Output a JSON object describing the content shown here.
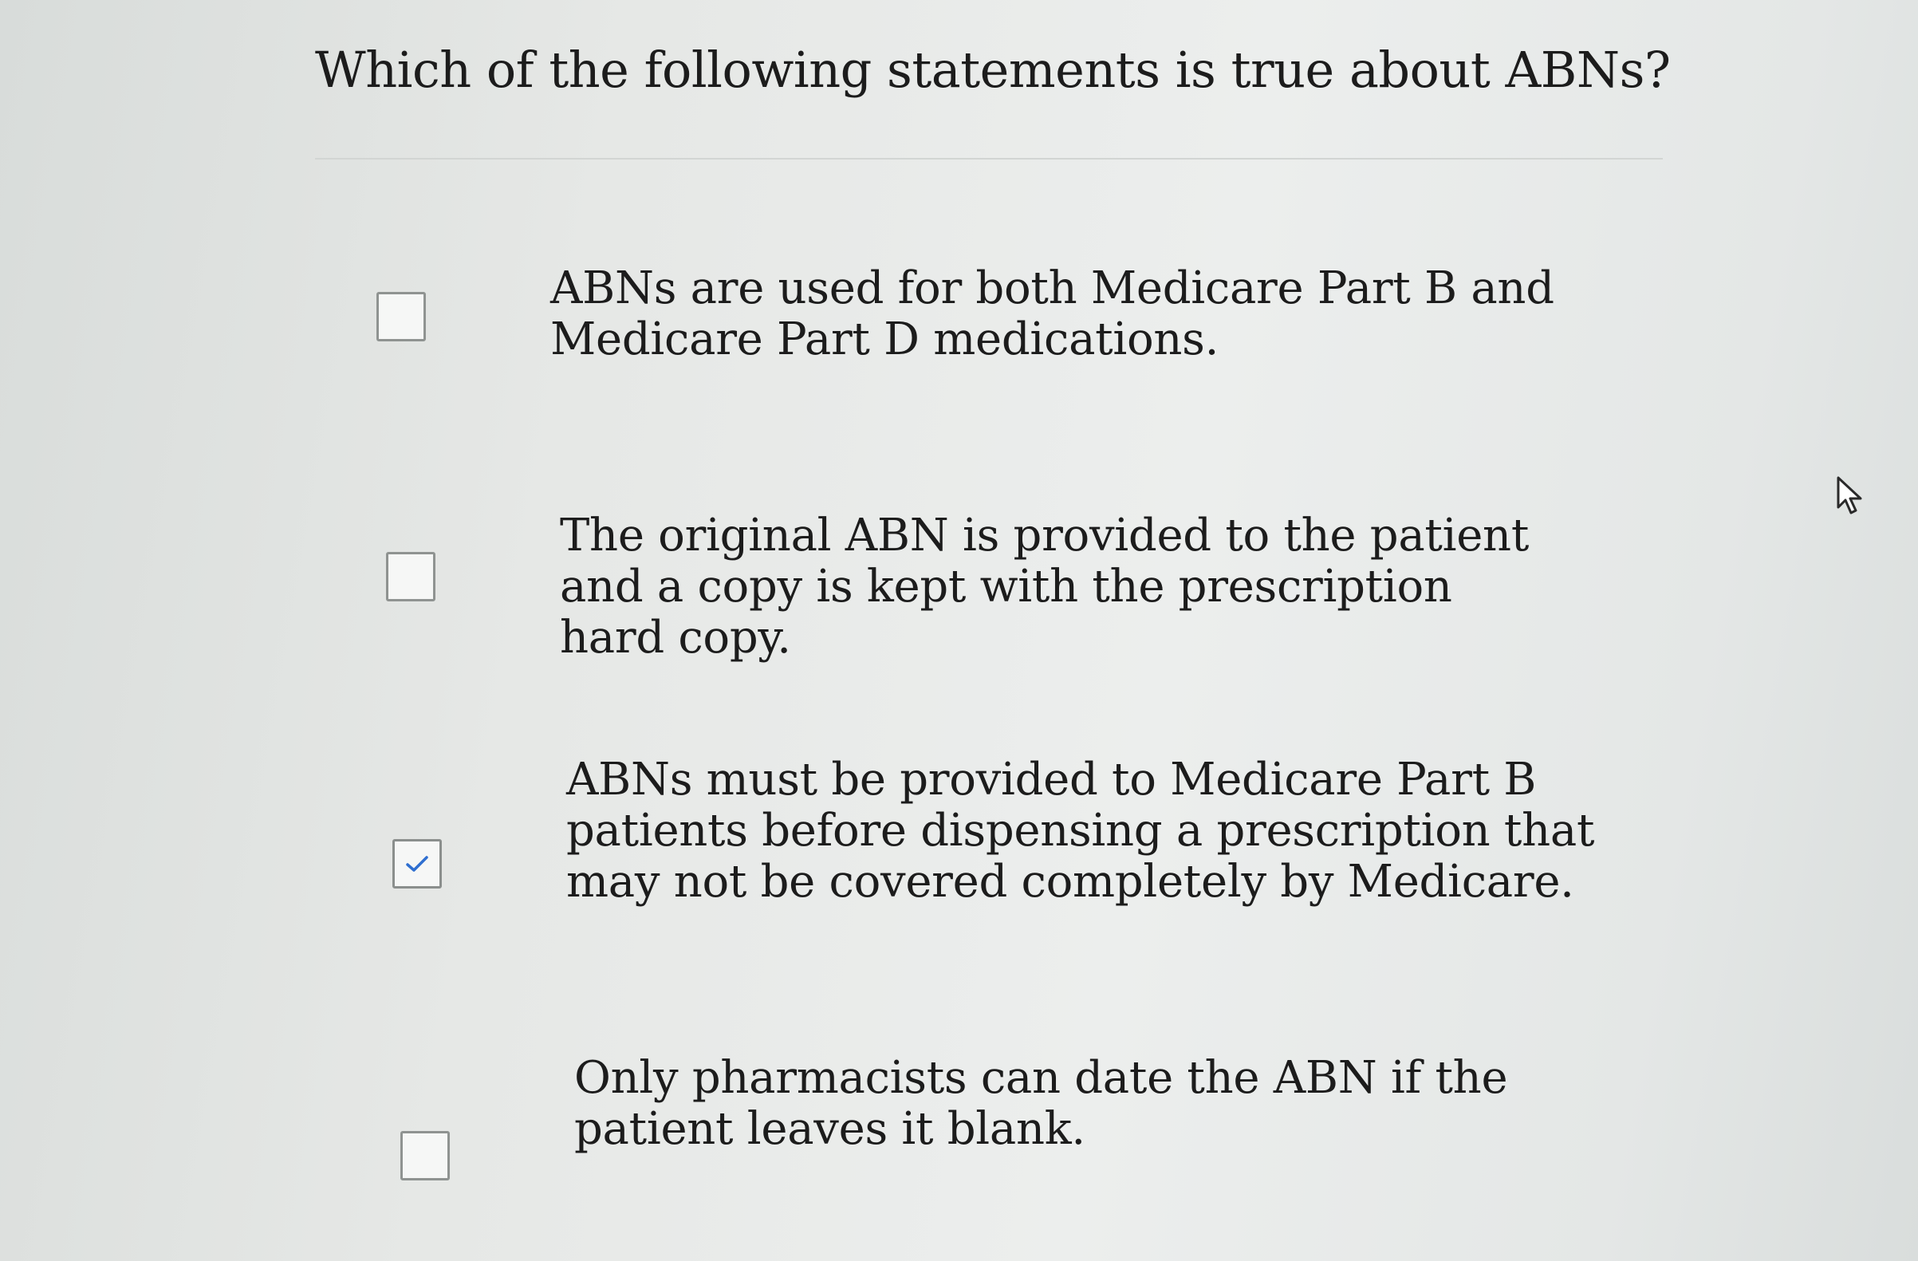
{
  "question": {
    "title": "Which of the following statements is true about ABNs?"
  },
  "options": [
    {
      "text": "ABNs are used for both Medicare Part B and Medicare Part D medications.",
      "checked": false
    },
    {
      "text": "The original ABN is provided to the patient and a copy is kept with the prescription hard copy.",
      "checked": false
    },
    {
      "text": "ABNs must be provided to Medicare Part B patients before dispensing a prescription that may not be covered completely by Medicare.",
      "checked": true
    },
    {
      "text": "Only pharmacists can date the ABN if the patient leaves it blank.",
      "checked": false
    }
  ],
  "colors": {
    "checkmark": "#2f6fd0",
    "checkbox_border": "#8f9391",
    "text": "#1c1c1c"
  },
  "icons": {
    "cursor": "mouse-pointer-icon",
    "check": "checkmark-icon"
  }
}
